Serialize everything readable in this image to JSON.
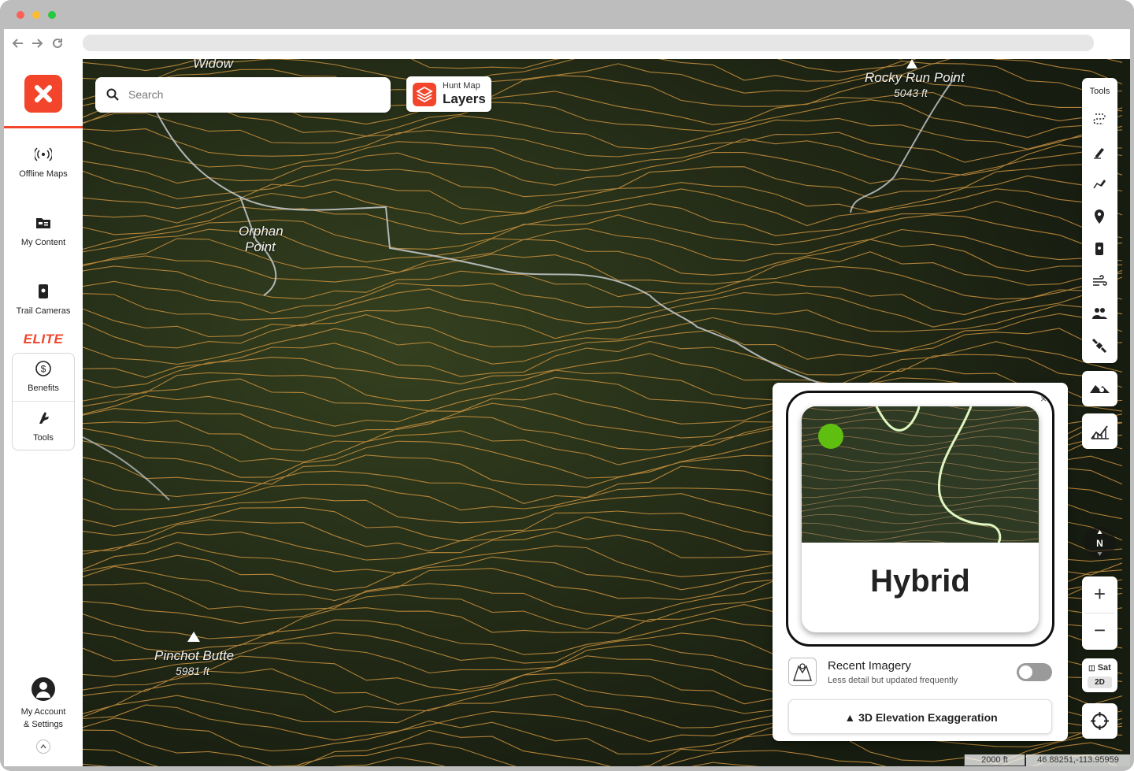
{
  "window": {
    "colors": {
      "close": "#fe5f57",
      "minimize": "#febc2e",
      "maximize": "#28c840",
      "accent": "#f2452b"
    }
  },
  "browser": {
    "back_icon": "arrow-left-icon",
    "forward_icon": "arrow-right-icon",
    "reload_icon": "reload-icon"
  },
  "sidebar": {
    "items": [
      {
        "label": "Offline Maps",
        "icon": "offline-signal-icon"
      },
      {
        "label": "My Content",
        "icon": "folder-icon"
      },
      {
        "label": "Trail Cameras",
        "icon": "trail-camera-icon"
      }
    ],
    "elite_label": "ELITE",
    "elite_items": [
      {
        "label": "Benefits",
        "icon": "dollar-circle-icon"
      },
      {
        "label": "Tools",
        "icon": "hand-tool-icon"
      }
    ],
    "account_line1": "My Account",
    "account_line2": "& Settings"
  },
  "map": {
    "search_placeholder": "Search",
    "layers_small": "Hunt Map",
    "layers_big": "Layers",
    "labels": [
      {
        "name": "Widow",
        "sub": ""
      },
      {
        "name": "Rocky Run Point",
        "sub": "5043 ft"
      },
      {
        "name": "Orphan",
        "sub": ""
      },
      {
        "name": "Point",
        "sub": ""
      },
      {
        "name": "Pinchot Butte",
        "sub": "5981 ft"
      }
    ],
    "tools_title": "Tools",
    "compass_label": "N",
    "zoom_in": "+",
    "zoom_out": "−",
    "sat_label": "Sat",
    "mode_label": "2D",
    "scale_label": "2000 ft",
    "coordinates": "46.88251,-113.95959"
  },
  "panel": {
    "card_title": "Hybrid",
    "close_label": "×",
    "recent_title": "Recent Imagery",
    "recent_sub": "Less detail but updated frequently",
    "recent_toggle_on": false,
    "elevation_label": "3D Elevation Exaggeration"
  }
}
